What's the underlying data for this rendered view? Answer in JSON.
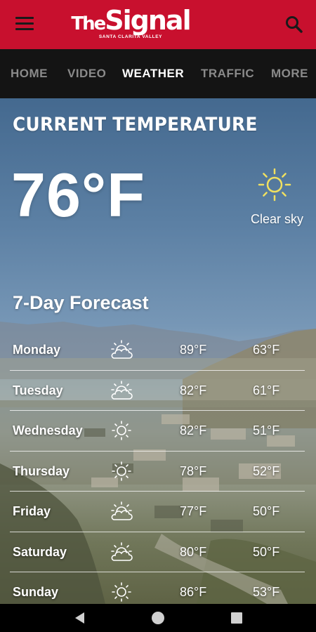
{
  "header": {
    "logo_the": "The",
    "logo_signal": "Signal",
    "logo_sub": "SANTA CLARITA VALLEY",
    "menu_icon": "hamburger-menu-icon",
    "search_icon": "search-icon",
    "background_color": "#c8102e"
  },
  "nav": {
    "tabs": [
      {
        "label": "HOME",
        "active": false
      },
      {
        "label": "VIDEO",
        "active": false
      },
      {
        "label": "WEATHER",
        "active": true
      },
      {
        "label": "TRAFFIC",
        "active": false
      },
      {
        "label": "MORE",
        "active": false
      }
    ]
  },
  "current": {
    "title": "CURRENT TEMPERATURE",
    "temperature": "76°F",
    "icon": "sun-icon",
    "condition": "Clear sky"
  },
  "forecast": {
    "title": "7-Day Forecast",
    "days": [
      {
        "day": "Monday",
        "icon": "sun-cloud-icon",
        "high": "89°F",
        "low": "63°F"
      },
      {
        "day": "Tuesday",
        "icon": "sun-cloud-icon",
        "high": "82°F",
        "low": "61°F"
      },
      {
        "day": "Wednesday",
        "icon": "sun-icon",
        "high": "82°F",
        "low": "51°F"
      },
      {
        "day": "Thursday",
        "icon": "sun-icon",
        "high": "78°F",
        "low": "52°F"
      },
      {
        "day": "Friday",
        "icon": "sun-cloud-icon",
        "high": "77°F",
        "low": "50°F"
      },
      {
        "day": "Saturday",
        "icon": "sun-cloud-icon",
        "high": "80°F",
        "low": "50°F"
      },
      {
        "day": "Sunday",
        "icon": "sun-icon",
        "high": "86°F",
        "low": "53°F"
      }
    ]
  },
  "system_nav": {
    "back_icon": "back-triangle-icon",
    "home_icon": "home-circle-icon",
    "recents_icon": "recents-square-icon"
  }
}
